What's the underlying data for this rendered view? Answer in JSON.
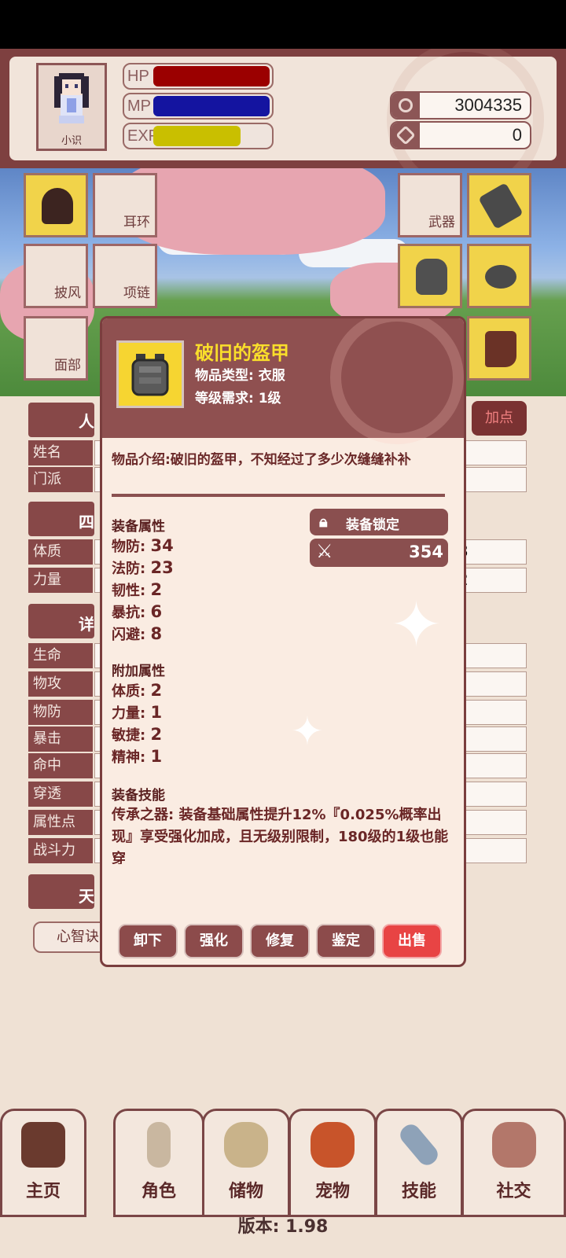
{
  "header": {
    "avatar_name": "小识",
    "stats": [
      {
        "label": "HP",
        "fill": 1.0,
        "color": "#9b0000"
      },
      {
        "label": "MP",
        "fill": 1.0,
        "color": "#1414a0"
      },
      {
        "label": "EXP",
        "fill": 0.75,
        "color": "#c9bf00"
      }
    ],
    "currency": [
      {
        "icon": "coin-icon",
        "value": "3004335"
      },
      {
        "icon": "gem-icon",
        "value": "0"
      }
    ]
  },
  "equipment_slots": {
    "left": [
      {
        "label": "",
        "icon": "helmet-icon",
        "equipped": true
      },
      {
        "label": "耳环",
        "equipped": false
      },
      {
        "label": "披风",
        "equipped": false
      },
      {
        "label": "项链",
        "equipped": false
      },
      {
        "label": "面部",
        "equipped": false
      }
    ],
    "right": [
      {
        "label": "武器",
        "equipped": false
      },
      {
        "label": "",
        "icon": "bracer-icon",
        "equipped": true
      },
      {
        "label": "",
        "icon": "armor-icon",
        "equipped": true
      },
      {
        "label": "",
        "icon": "belt-icon",
        "equipped": true
      },
      {
        "label": "",
        "icon": "boots-icon",
        "equipped": true
      }
    ]
  },
  "background_panel": {
    "sections": [
      "人",
      "四",
      "详",
      "天"
    ],
    "add_points": "加点",
    "info_rows": [
      "姓名",
      "门派"
    ],
    "base_rows": [
      {
        "label": "体质",
        "value": "3"
      },
      {
        "label": "力量",
        "value": "2"
      }
    ],
    "detail_rows": [
      "生命",
      "物攻",
      "物防",
      "暴击",
      "命中",
      "穿透",
      "属性点",
      "战斗力"
    ],
    "talent_button": "心智诀"
  },
  "item_popup": {
    "name": "破旧的盔甲",
    "type_label": "物品类型: 衣服",
    "level_label": "等级需求: 1级",
    "description": "物品介绍:破旧的盔甲，不知经过了多少次缝缝补补",
    "lock_label": "装备锁定",
    "power_value": "354",
    "base_title": "装备属性",
    "base_attrs": [
      {
        "name": "物防: ",
        "value": "34"
      },
      {
        "name": "法防: ",
        "value": "23"
      },
      {
        "name": "韧性: ",
        "value": "2"
      },
      {
        "name": "暴抗: ",
        "value": "6"
      },
      {
        "name": "闪避: ",
        "value": "8"
      }
    ],
    "extra_title": "附加属性",
    "extra_attrs": [
      {
        "name": "体质: ",
        "value": "2"
      },
      {
        "name": "力量: ",
        "value": "1"
      },
      {
        "name": "敏捷: ",
        "value": "2"
      },
      {
        "name": "精神: ",
        "value": "1"
      }
    ],
    "skill_title": "装备技能",
    "skill_text": "传承之器: 装备基础属性提升12%『0.025%概率出现』享受强化加成，且无级别限制，180级的1级也能穿",
    "actions": [
      {
        "label": "卸下",
        "style": "normal"
      },
      {
        "label": "强化",
        "style": "normal"
      },
      {
        "label": "修复",
        "style": "normal"
      },
      {
        "label": "鉴定",
        "style": "normal"
      },
      {
        "label": "出售",
        "style": "danger"
      }
    ]
  },
  "bottom_nav": [
    {
      "label": "主页",
      "icon": "home-gate-icon"
    },
    {
      "label": "角色",
      "icon": "character-icon"
    },
    {
      "label": "储物",
      "icon": "storage-bag-icon"
    },
    {
      "label": "宠物",
      "icon": "pet-fox-icon"
    },
    {
      "label": "技能",
      "icon": "sword-skill-icon"
    },
    {
      "label": "社交",
      "icon": "handshake-icon"
    }
  ],
  "version": "版本: 1.98",
  "colors": {
    "panel_dark": "#874848",
    "panel_light": "#efe1d4",
    "item_name": "#f9de2b",
    "sell_button": "#e84444"
  }
}
